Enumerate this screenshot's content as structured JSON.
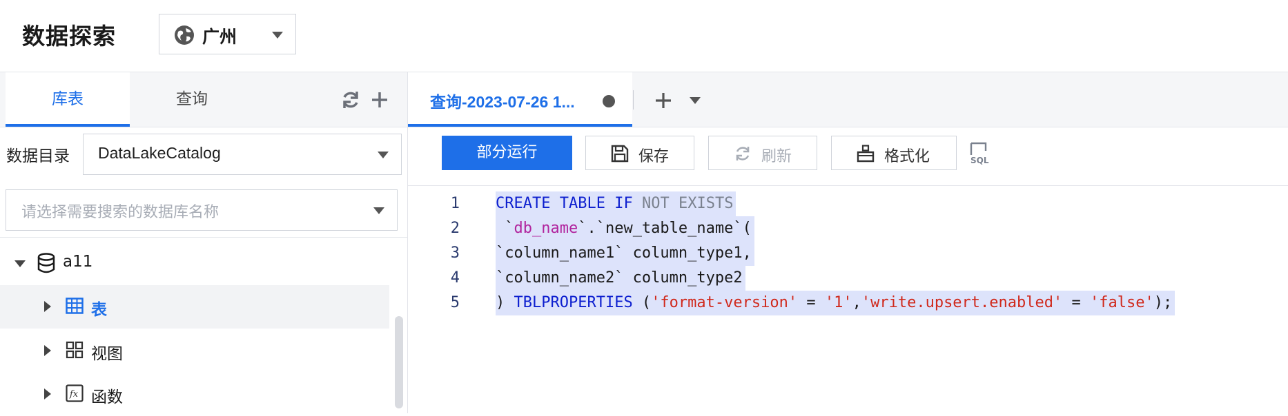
{
  "header": {
    "title": "数据探索",
    "region": "广州"
  },
  "left_panel": {
    "tabs": [
      {
        "label": "库表",
        "active": true
      },
      {
        "label": "查询",
        "active": false
      }
    ],
    "catalog": {
      "label": "数据目录",
      "value": "DataLakeCatalog"
    },
    "db_search": {
      "placeholder": "请选择需要搜索的数据库名称"
    },
    "tree": [
      {
        "label": "a11",
        "icon": "database-icon",
        "expanded": true,
        "level": 0
      },
      {
        "label": "表",
        "icon": "table-icon",
        "expanded": false,
        "level": 1,
        "selected": true
      },
      {
        "label": "视图",
        "icon": "view-icon",
        "expanded": false,
        "level": 1
      },
      {
        "label": "函数",
        "icon": "function-icon",
        "expanded": false,
        "level": 1
      }
    ]
  },
  "query_tabs": [
    {
      "title": "查询-2023-07-26 1...",
      "unsaved": true
    }
  ],
  "toolbar": {
    "run_partial": "部分运行",
    "save": "保存",
    "refresh": "刷新",
    "format": "格式化",
    "sql_icon": "SQL"
  },
  "editor": {
    "line_numbers": [
      "1",
      "2",
      "3",
      "4",
      "5"
    ],
    "lines": [
      "CREATE TABLE IF NOT EXISTS",
      " `db_name`.`new_table_name`(",
      "`column_name1` column_type1,",
      "`column_name2` column_type2",
      ") TBLPROPERTIES ('format-version' = '1','write.upsert.enabled' = 'false');"
    ],
    "tokens": {
      "l1": [
        "CREATE",
        "TABLE",
        "IF",
        "NOT",
        "EXISTS"
      ],
      "l2": [
        " `",
        "db_name",
        "`.`new_table_name`("
      ],
      "l3": [
        "`column_name1` column_type1,"
      ],
      "l4": [
        "`column_name2` column_type2"
      ],
      "l5": [
        ") ",
        "TBLPROPERTIES",
        " (",
        "'format-version'",
        " = ",
        "'1'",
        ",",
        "'write.upsert.enabled'",
        " = ",
        "'false'",
        ");"
      ]
    }
  },
  "colors": {
    "accent": "#1e6fe8",
    "selection": "#dde3fb",
    "string": "#d0291c",
    "keyword": "#0d1fcf",
    "identifier": "#b1259e"
  }
}
